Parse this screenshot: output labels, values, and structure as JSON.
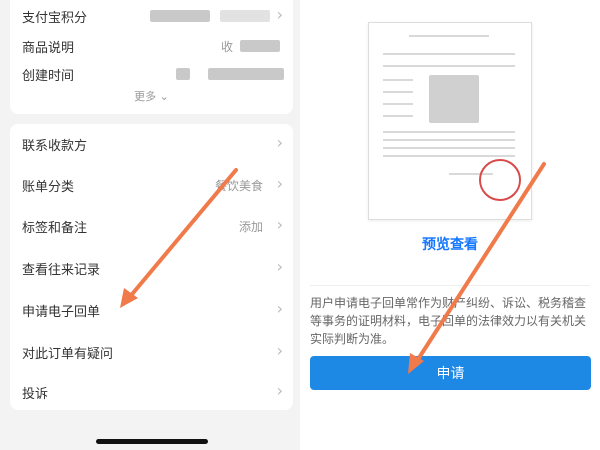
{
  "left_panel": {
    "top_rows": [
      {
        "label": "支付宝积分"
      },
      {
        "label": "商品说明",
        "value_prefix": "收"
      },
      {
        "label": "创建时间"
      }
    ],
    "more_label": "更多",
    "rows": [
      {
        "label": "联系收款方",
        "value": ""
      },
      {
        "label": "账单分类",
        "value": "餐饮美食"
      },
      {
        "label": "标签和备注",
        "value": "添加"
      },
      {
        "label": "查看往来记录",
        "value": ""
      },
      {
        "label": "申请电子回单",
        "value": ""
      },
      {
        "label": "对此订单有疑问",
        "value": ""
      },
      {
        "label": "投诉",
        "value": ""
      }
    ]
  },
  "right_panel": {
    "preview_label": "预览查看",
    "description": "用户申请电子回单常作为财产纠纷、诉讼、税务稽查等事务的证明材料，电子回单的法律效力以有关机关实际判断为准。",
    "apply_label": "申请"
  },
  "colors": {
    "accent": "#1e88e5",
    "arrow": "#f07a4a",
    "background": "#f3f3f3"
  },
  "icons": {
    "chevron": "chevron-right-icon",
    "more": "chevron-down-icon"
  }
}
